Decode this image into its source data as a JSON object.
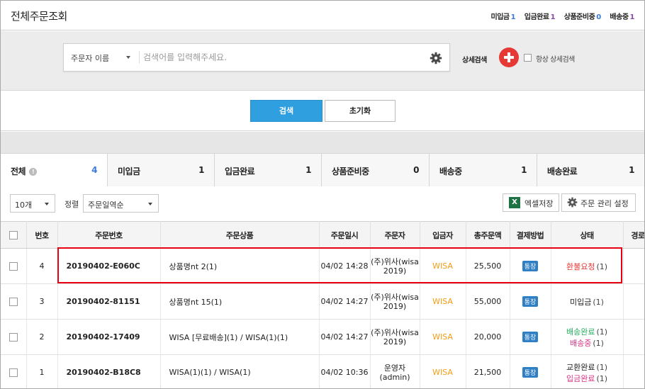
{
  "header": {
    "title": "전체주문조회",
    "summary": [
      {
        "label": "미입금",
        "count": "1",
        "color": "blue"
      },
      {
        "label": "입금완료",
        "count": "1",
        "color": "purple"
      },
      {
        "label": "상품준비중",
        "count": "0",
        "color": "blue"
      },
      {
        "label": "배송중",
        "count": "1",
        "color": "purple"
      }
    ]
  },
  "search": {
    "type_selected": "주문자 이름",
    "placeholder": "검색어를 입력해주세요.",
    "advanced_label": "상세검색",
    "always_label": "항상 상세검색"
  },
  "actions": {
    "search": "검색",
    "reset": "초기화"
  },
  "tabs": [
    {
      "label": "전체",
      "count": "4",
      "info": true
    },
    {
      "label": "미입금",
      "count": "1"
    },
    {
      "label": "입금완료",
      "count": "1"
    },
    {
      "label": "상품준비중",
      "count": "0"
    },
    {
      "label": "배송중",
      "count": "1"
    },
    {
      "label": "배송완료",
      "count": "1"
    }
  ],
  "toolbar": {
    "page_size": "10개",
    "sort_label": "정렬",
    "sort_selected": "주문일역순",
    "excel_label": "엑셀저장",
    "settings_label": "주문 관리 설정"
  },
  "table": {
    "headers": [
      "",
      "번호",
      "주문번호",
      "주문상품",
      "주문일시",
      "주문자",
      "입금자",
      "총주문액",
      "결제방법",
      "상태",
      "경로"
    ],
    "rows": [
      {
        "no": "4",
        "order_no": "20190402-E060C",
        "product": "상품명nt 2(1)",
        "date": "04/02 14:28",
        "orderer": "(주)위사(wisa 2019)",
        "payer": "WISA",
        "total": "25,500",
        "pay": "통장",
        "status": [
          {
            "text": "환불요청",
            "count": "(1)",
            "color": "red"
          }
        ]
      },
      {
        "no": "3",
        "order_no": "20190402-81151",
        "product": "상품명nt 15(1)",
        "date": "04/02 14:27",
        "orderer": "(주)위사(wisa 2019)",
        "payer": "WISA",
        "total": "55,000",
        "pay": "통장",
        "status": [
          {
            "text": "미입금",
            "count": "(1)",
            "color": "plain"
          }
        ]
      },
      {
        "no": "2",
        "order_no": "20190402-17409",
        "product": "WISA [무료배송](1) / WISA(1)(1)",
        "date": "04/02 14:27",
        "orderer": "(주)위사(wisa 2019)",
        "payer": "WISA",
        "total": "20,000",
        "pay": "통장",
        "status": [
          {
            "text": "배송완료",
            "count": "(1)",
            "color": "green"
          },
          {
            "text": "배송중",
            "count": "(1)",
            "color": "pink"
          }
        ]
      },
      {
        "no": "1",
        "order_no": "20190402-B18C8",
        "product": "WISA(1)(1) / WISA(1)",
        "date": "04/02 10:36",
        "orderer": "운영자(admin)",
        "payer": "WISA",
        "total": "21,500",
        "pay": "통장",
        "status": [
          {
            "text": "교환완료",
            "count": "(1)",
            "color": "plain"
          },
          {
            "text": "입금완료",
            "count": "(1)",
            "color": "pink"
          }
        ]
      }
    ]
  },
  "colors": {
    "accent": "#2f9fe0",
    "highlight": "#e60012",
    "plus": "#e53935",
    "wisa": "#f39c12"
  }
}
